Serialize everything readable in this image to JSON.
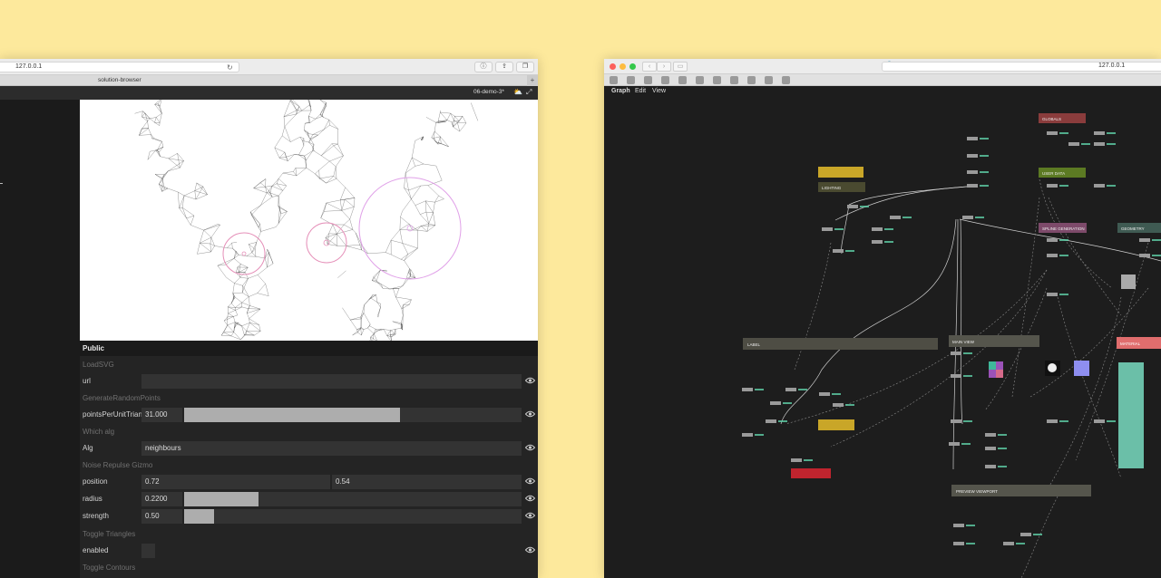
{
  "left_window": {
    "url": "127.0.0.1",
    "tab_title": "solution-browser",
    "project_name": "06-demo-3*",
    "panel": {
      "title": "Public",
      "sections": {
        "load_svg": "LoadSVG",
        "random_points": "GenerateRandomPoints",
        "which_alg": "Which alg",
        "noise_gizmo": "Noise Repulse Gizmo",
        "toggle_triangles": "Toggle Triangles",
        "toggle_contours": "Toggle Contours"
      },
      "params": {
        "url": {
          "label": "url",
          "value": ""
        },
        "points": {
          "label": "pointsPerUnitTrian",
          "value": "31.000",
          "level": 0.64
        },
        "alg": {
          "label": "Alg",
          "value": "neighbours"
        },
        "position": {
          "label": "position",
          "x": "0.72",
          "y": "0.54"
        },
        "radius": {
          "label": "radius",
          "value": "0.2200",
          "level": 0.22
        },
        "strength": {
          "label": "strength",
          "value": "0.50",
          "level": 0.09
        },
        "enabled": {
          "label": "enabled"
        }
      }
    }
  },
  "right_window": {
    "url": "127.0.0.1",
    "menu": [
      "Graph",
      "Edit",
      "View"
    ],
    "graph_groups": {
      "globals": {
        "label": "GLOBALS",
        "color": "#8a3c3c"
      },
      "user_data": {
        "label": "USER DATA",
        "color": "#5c7a23"
      },
      "lighting": {
        "label": "LIGHTING",
        "color": "#4a4a30"
      },
      "spline_generation": {
        "label": "SPLINE GENERATION",
        "color": "#7d4a6a"
      },
      "geometry": {
        "label": "GEOMETRY",
        "color": "#3f5a52"
      },
      "label": {
        "label": "LABEL",
        "color": "#4e4d44"
      },
      "main_view": {
        "label": "MAIN VIEW",
        "color": "#55554c"
      },
      "material": {
        "label": "MATERIAL",
        "color": "#e06d6d"
      },
      "preview_viewport": {
        "label": "PREVIEW VIEWPORT",
        "color": "#55554c"
      }
    }
  },
  "colors": {
    "background": "#fde99c",
    "panel": "#242424",
    "field": "#333333",
    "slider_fill": "#adadad",
    "gizmo": "#e58fb8",
    "gizmo_ring": "#e0a0e8",
    "node_text": "#5fd0a8",
    "error_node": "#c0242e",
    "comment_node": "#c9a628"
  },
  "icons": {
    "reload": "reload-icon",
    "eye": "eye-icon",
    "fullscreen": "fullscreen-icon",
    "lock": "lock-icon"
  }
}
